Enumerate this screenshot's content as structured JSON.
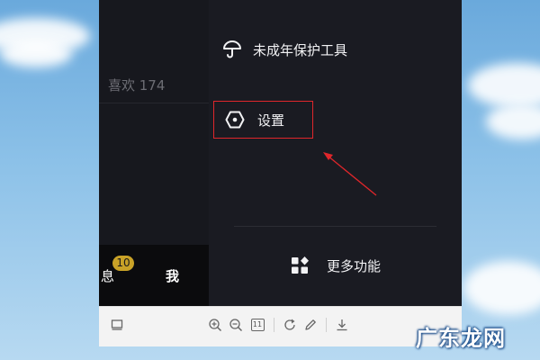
{
  "profile": {
    "likes_label": "喜欢 174"
  },
  "bottom_nav": {
    "messages_label": "息",
    "messages_badge": "10",
    "me_label": "我"
  },
  "menu": {
    "minor_tools_label": "未成年保护工具",
    "settings_label": "设置",
    "more_features_label": "更多功能"
  },
  "toolbar": {
    "page_num": "11"
  },
  "watermark": {
    "text": "广东龙网"
  },
  "colors": {
    "highlight_box": "#e0262b",
    "badge": "#c9a227",
    "panel_bg": "#1a1b22"
  }
}
